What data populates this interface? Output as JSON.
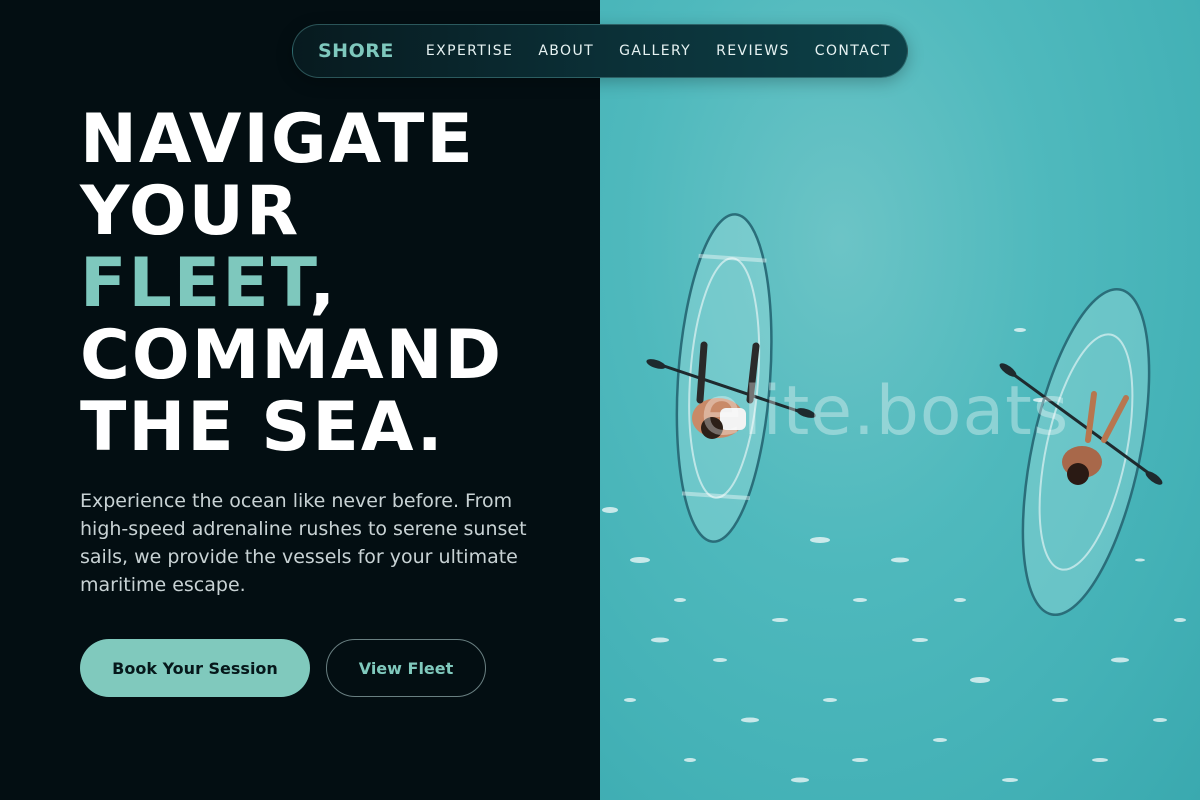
{
  "nav": {
    "brand": "SHORE",
    "links": [
      "EXPERTISE",
      "ABOUT",
      "GALLERY",
      "REVIEWS",
      "CONTACT"
    ]
  },
  "hero": {
    "title_line1": "NAVIGATE",
    "title_line2": "YOUR",
    "title_accent": "FLEET",
    "title_comma": ",",
    "title_line4": "COMMAND",
    "title_line5": "THE SEA.",
    "description": "Experience the ocean like never before. From high-speed adrenaline rushes to serene sunset sails, we provide the vessels for your ultimate maritime escape.",
    "primary_button": "Book Your Session",
    "secondary_button": "View Fleet"
  },
  "image": {
    "watermark": "elite.boats",
    "subject": "aerial-clear-kayaks-icon"
  },
  "colors": {
    "background": "#030e12",
    "accent": "#7ec8bd",
    "water": "#4fb9bd"
  }
}
